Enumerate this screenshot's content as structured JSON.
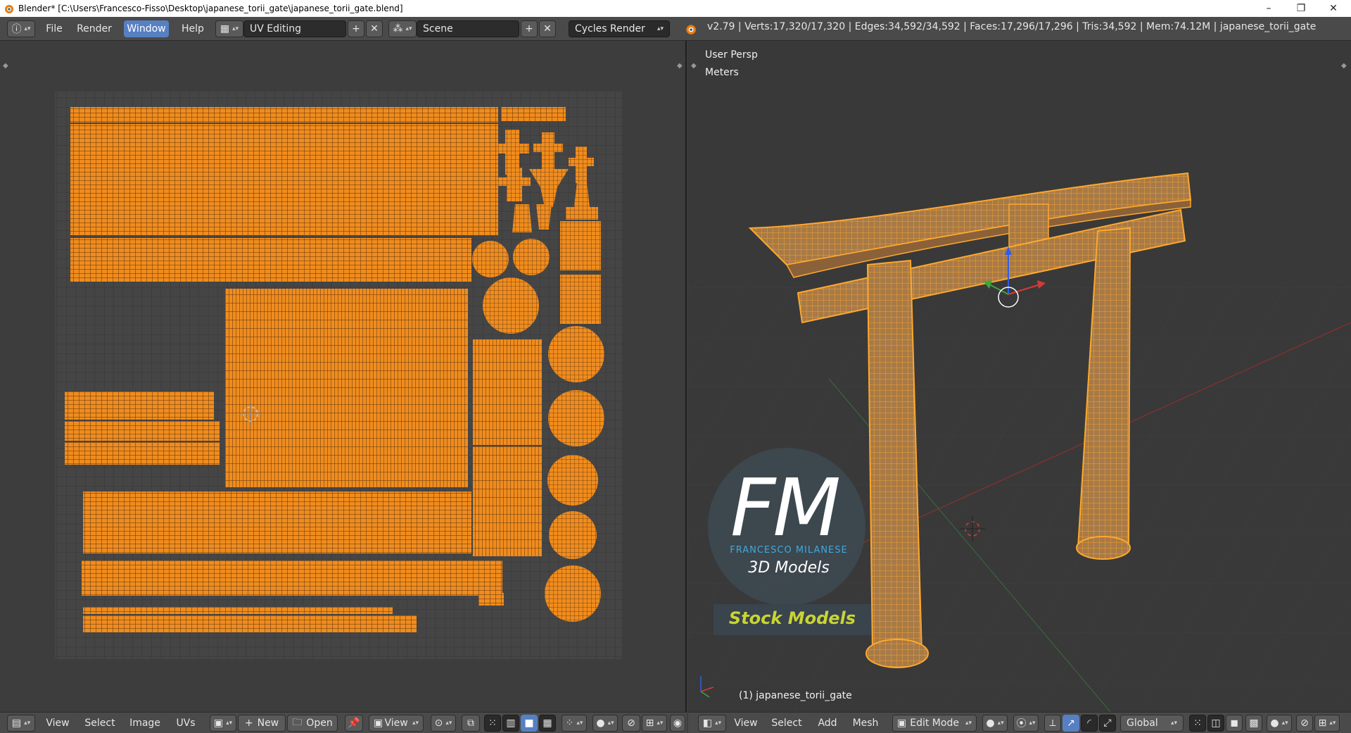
{
  "window": {
    "title": "Blender* [C:\\Users\\Francesco-Fisso\\Desktop\\japanese_torii_gate\\japanese_torii_gate.blend]",
    "minimize": "–",
    "maximize": "❐",
    "close": "✕"
  },
  "menu": {
    "items": [
      "File",
      "Render",
      "Window",
      "Help"
    ],
    "active": "Window"
  },
  "screen_layout": {
    "value": "UV Editing"
  },
  "scene": {
    "value": "Scene"
  },
  "render_engine": {
    "value": "Cycles Render"
  },
  "stats": {
    "text": "v2.79 | Verts:17,320/17,320 | Edges:34,592/34,592 | Faces:17,296/17,296 | Tris:34,592 | Mem:74.12M | japanese_torii_gate"
  },
  "viewport": {
    "perspective": "User Persp",
    "units": "Meters",
    "object_label": "(1) japanese_torii_gate"
  },
  "watermark": {
    "letters": "FM",
    "brand": "FRANCESCO MILANESE",
    "tagline": "3D Models",
    "stock": "Stock Models"
  },
  "uv_footer": {
    "menu": [
      "View",
      "Select",
      "Image",
      "UVs"
    ],
    "new_label": "New",
    "open_label": "Open",
    "view_label": "View"
  },
  "view3d_footer": {
    "menu": [
      "View",
      "Select",
      "Add",
      "Mesh"
    ],
    "mode": "Edit Mode",
    "orientation": "Global"
  },
  "colors": {
    "uv_orange": "#ff8c00",
    "grid_bg": "#444444",
    "header": "#4a4a4a",
    "accent_blue": "#5680c2"
  }
}
